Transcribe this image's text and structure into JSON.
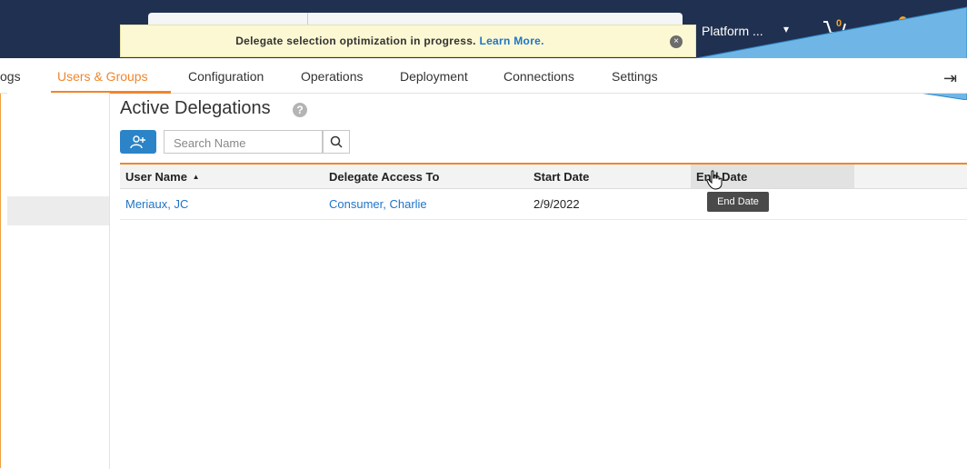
{
  "header": {
    "account": {
      "label": "Platform ...",
      "caret": "▾"
    },
    "cart": {
      "count": "0",
      "icon": "cart-icon"
    },
    "notifications": {
      "icon": "bell-icon",
      "accent": "#f6a623"
    },
    "avatar": {
      "icon": "user-avatar"
    }
  },
  "banner": {
    "message": "Delegate selection optimization in progress.",
    "link": "Learn More.",
    "close_icon": "×"
  },
  "nav": {
    "items": [
      {
        "label": "ogs"
      },
      {
        "label": "Users & Groups",
        "active": true
      },
      {
        "label": "Configuration"
      },
      {
        "label": "Operations"
      },
      {
        "label": "Deployment"
      },
      {
        "label": "Connections"
      },
      {
        "label": "Settings"
      }
    ],
    "exit_icon": "⇥"
  },
  "page": {
    "title": "Active Delegations",
    "help_icon": "?"
  },
  "toolbar": {
    "add_icon": "👤+",
    "search_placeholder": "Search Name",
    "search_icon": "⌕"
  },
  "grid": {
    "columns": [
      {
        "label": "User Name",
        "sort": "▲"
      },
      {
        "label": "Delegate Access To"
      },
      {
        "label": "Start Date"
      },
      {
        "label": "End Date"
      }
    ],
    "rows": [
      {
        "user": "Meriaux, JC",
        "delegate": "Consumer, Charlie",
        "start": "2/9/2022",
        "end": ""
      }
    ]
  },
  "tooltip": {
    "text": "End Date"
  },
  "colors": {
    "accent": "#f0862b",
    "link": "#1f74c8",
    "topbar": "#203050",
    "primary_button": "#2b84c7"
  }
}
